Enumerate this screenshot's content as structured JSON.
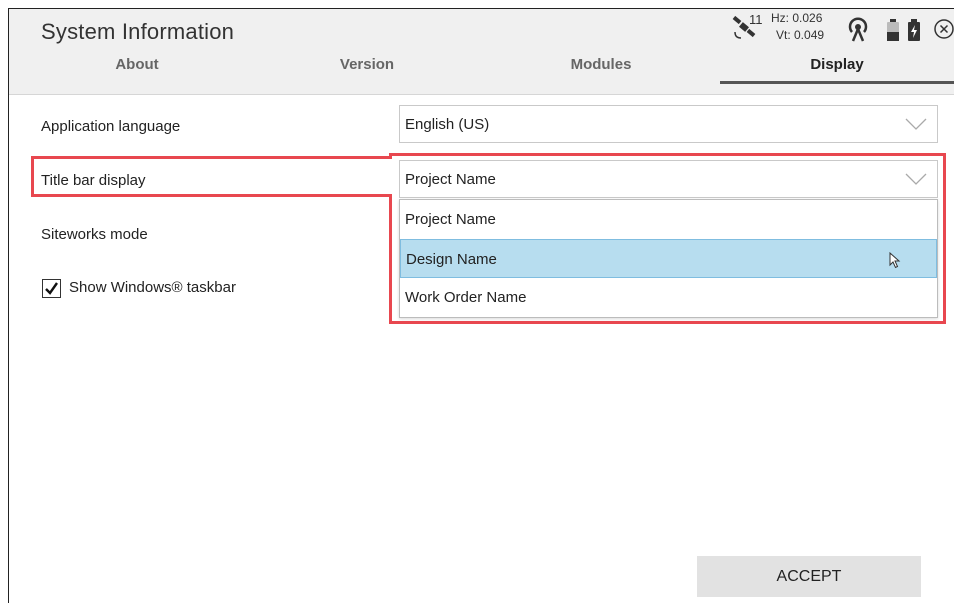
{
  "app": {
    "title": "System Information"
  },
  "tabs": [
    {
      "label": "About"
    },
    {
      "label": "Version"
    },
    {
      "label": "Modules"
    },
    {
      "label": "Display",
      "active": true
    }
  ],
  "status": {
    "satellite_count": "11",
    "hz": "Hz: 0.026",
    "vt": "Vt: 0.049",
    "icons": [
      "satellite-icon",
      "radio-icon",
      "battery-icon",
      "battery-charging-icon",
      "close-icon"
    ]
  },
  "settings": {
    "app_language": {
      "label": "Application language",
      "value": "English (US)"
    },
    "title_bar": {
      "label": "Title bar display",
      "value": "Project Name",
      "options": [
        "Project Name",
        "Design Name",
        "Work Order Name"
      ],
      "hovered": "Design Name"
    },
    "siteworks": {
      "label": "Siteworks mode"
    },
    "taskbar": {
      "label": "Show Windows® taskbar",
      "checked": true
    }
  },
  "footer": {
    "accept_label": "ACCEPT"
  },
  "colors": {
    "highlight": "#e8474f",
    "hover": "#b7ddef",
    "header_bg": "#f0f0f0"
  }
}
